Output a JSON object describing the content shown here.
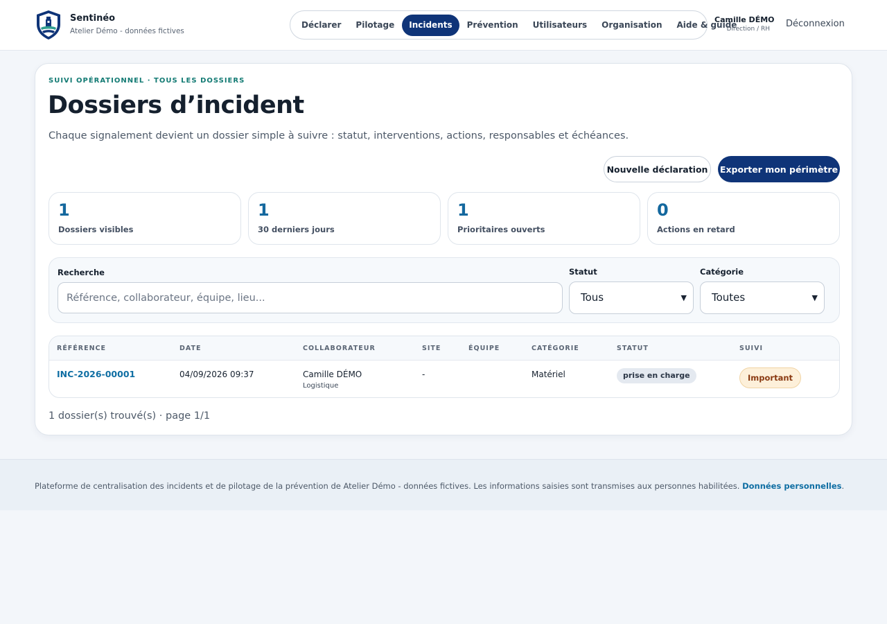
{
  "brand": {
    "name": "Sentinéo",
    "subtitle": "Atelier Démo - données fictives"
  },
  "nav": {
    "items": [
      {
        "label": "Déclarer",
        "active": false
      },
      {
        "label": "Pilotage",
        "active": false
      },
      {
        "label": "Incidents",
        "active": true
      },
      {
        "label": "Prévention",
        "active": false
      },
      {
        "label": "Utilisateurs",
        "active": false
      },
      {
        "label": "Organisation",
        "active": false
      },
      {
        "label": "Aide & guide",
        "active": false
      }
    ]
  },
  "user": {
    "name": "Camille DÉMO",
    "role": "Direction / RH",
    "logout_label": "Déconnexion"
  },
  "page": {
    "eyebrow": "SUIVI OPÉRATIONNEL · TOUS LES DOSSIERS",
    "title": "Dossiers d’incident",
    "lead": "Chaque signalement devient un dossier simple à suivre : statut, interventions, actions, responsables et échéances.",
    "new_label": "Nouvelle déclaration",
    "export_label": "Exporter mon périmètre"
  },
  "stats": [
    {
      "value": "1",
      "label": "Dossiers visibles"
    },
    {
      "value": "1",
      "label": "30 derniers jours"
    },
    {
      "value": "1",
      "label": "Prioritaires ouverts"
    },
    {
      "value": "0",
      "label": "Actions en retard"
    }
  ],
  "filters": {
    "search_label": "Recherche",
    "search_placeholder": "Référence, collaborateur, équipe, lieu...",
    "search_value": "",
    "status_label": "Statut",
    "status_value": "Tous",
    "category_label": "Catégorie",
    "category_value": "Toutes"
  },
  "table": {
    "columns": [
      "RÉFÉRENCE",
      "DATE",
      "COLLABORATEUR",
      "SITE",
      "ÉQUIPE",
      "CATÉGORIE",
      "STATUT",
      "SUIVI"
    ],
    "rows": [
      {
        "reference": "INC-2026-00001",
        "date": "04/09/2026 09:37",
        "collaborator": "Camille DÉMO",
        "team": "Logistique",
        "site": "-",
        "equipe": "",
        "category": "Matériel",
        "status": "prise en charge",
        "followup": "Important"
      }
    ],
    "count_text": "1 dossier(s) trouvé(s) · page 1/1"
  },
  "footer": {
    "text": "Plateforme de centralisation des incidents et de pilotage de la prévention de Atelier Démo - données fictives. Les informations saisies sont transmises aux personnes habilitées.",
    "link_label": "Données personnelles",
    "trailing": "."
  },
  "colors": {
    "accent": "#0f3478",
    "link": "#0f6ea3",
    "eyebrow": "#127a73",
    "stat_value": "#14689e"
  }
}
